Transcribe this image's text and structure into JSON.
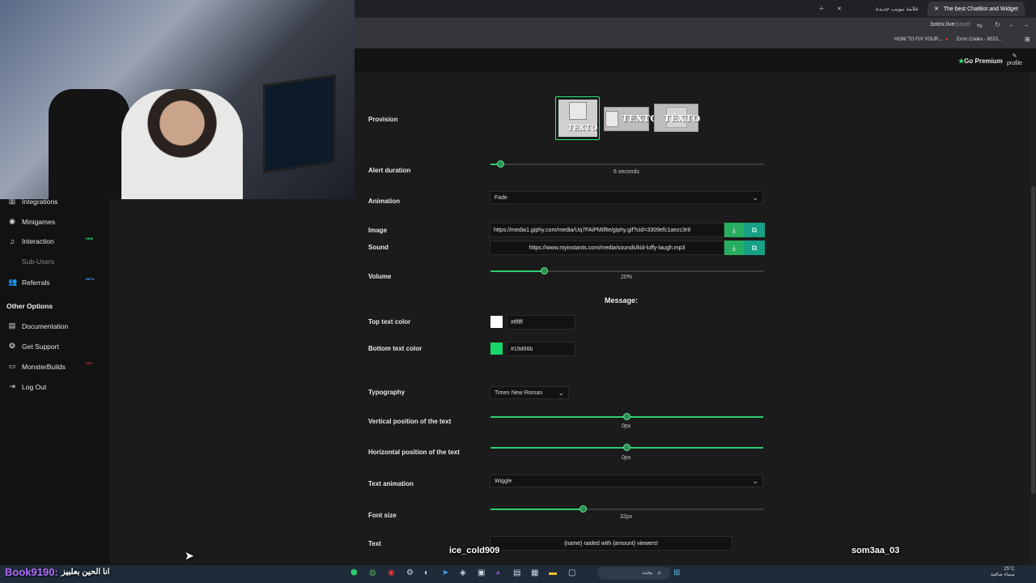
{
  "browser": {
    "tabs": [
      {
        "label": "علامة تبويب جديدة",
        "active": false
      },
      {
        "label": "The best ChatBot and Widget",
        "active": true
      }
    ],
    "url_host": "botrix.live",
    "url_path": "/panel",
    "bookmarks": [
      "HOW TO FIX YOUR...",
      "Error Codes - 6023..."
    ]
  },
  "header": {
    "premium_label": "Go Premium",
    "profile_label": "profile"
  },
  "sidebar": {
    "items": [
      {
        "label": "Integrations",
        "icon": "chart-icon"
      },
      {
        "label": "Minigames",
        "icon": "gamepad-icon"
      },
      {
        "label": "Interaction",
        "icon": "music-icon",
        "badge": "NEW"
      },
      {
        "label": "Sub-Users",
        "icon": "",
        "disabled": true
      },
      {
        "label": "Referrals",
        "icon": "users-icon",
        "badge": "BETA"
      }
    ],
    "other_title": "Other Options",
    "other_items": [
      {
        "label": "Documentation",
        "icon": "book-icon"
      },
      {
        "label": "Get Support",
        "icon": "support-icon"
      },
      {
        "label": "MonsterBuilds",
        "icon": "laptop-icon",
        "badge": "HOT"
      },
      {
        "label": "Log Out",
        "icon": "logout-icon"
      }
    ]
  },
  "form": {
    "provision_label": "Provision",
    "provision_text": "TEXTO",
    "alert_duration": {
      "label": "Alert duration",
      "value_text": "6 seconds",
      "fraction": 0.04
    },
    "animation": {
      "label": "Animation",
      "value": "Fade"
    },
    "image": {
      "label": "Image",
      "value": "https://media1.giphy.com/media/Uq7FAiPMIlfte/giphy.gif?cid=3309efc1aezc3r8"
    },
    "sound": {
      "label": "Sound",
      "value": "https://www.myinstants.com/media/sounds/kid-luffy-laugh.mp3"
    },
    "volume": {
      "label": "Volume",
      "value_text": "20%",
      "fraction": 0.2
    },
    "message_heading": "Message:",
    "top_text_color": {
      "label": "Top text color",
      "value": "#ffffff"
    },
    "bottom_text_color": {
      "label": "Bottom text color",
      "value": "#19d66b"
    },
    "typography": {
      "label": "Typography",
      "value": "Times New Roman"
    },
    "vertical_position": {
      "label": "Vertical position of the text",
      "value_text": "0px",
      "fraction": 0.5
    },
    "horizontal_position": {
      "label": "Horizontal position of the text",
      "value_text": "0px",
      "fraction": 0.5
    },
    "text_animation": {
      "label": "Text animation",
      "value": "Wiggle"
    },
    "font_size": {
      "label": "Font size",
      "value_text": "32px",
      "fraction": 0.34
    },
    "text": {
      "label": "Text",
      "value": "{name} raided with {amount} viewers!"
    }
  },
  "overlay": {
    "name_left": "ice_cold909",
    "name_right": "som3aa_03",
    "chat_user": "Book9190:",
    "chat_message": "انا الحين بعلبيز"
  },
  "taskbar": {
    "search_label": "بحث",
    "weather": "25°C",
    "clock_line2": "سماء صافية"
  },
  "colors": {
    "accent": "#2ee87a",
    "slider": "#2ecc71",
    "upload_button": "#27ae60",
    "swap_button": "#16a085"
  }
}
